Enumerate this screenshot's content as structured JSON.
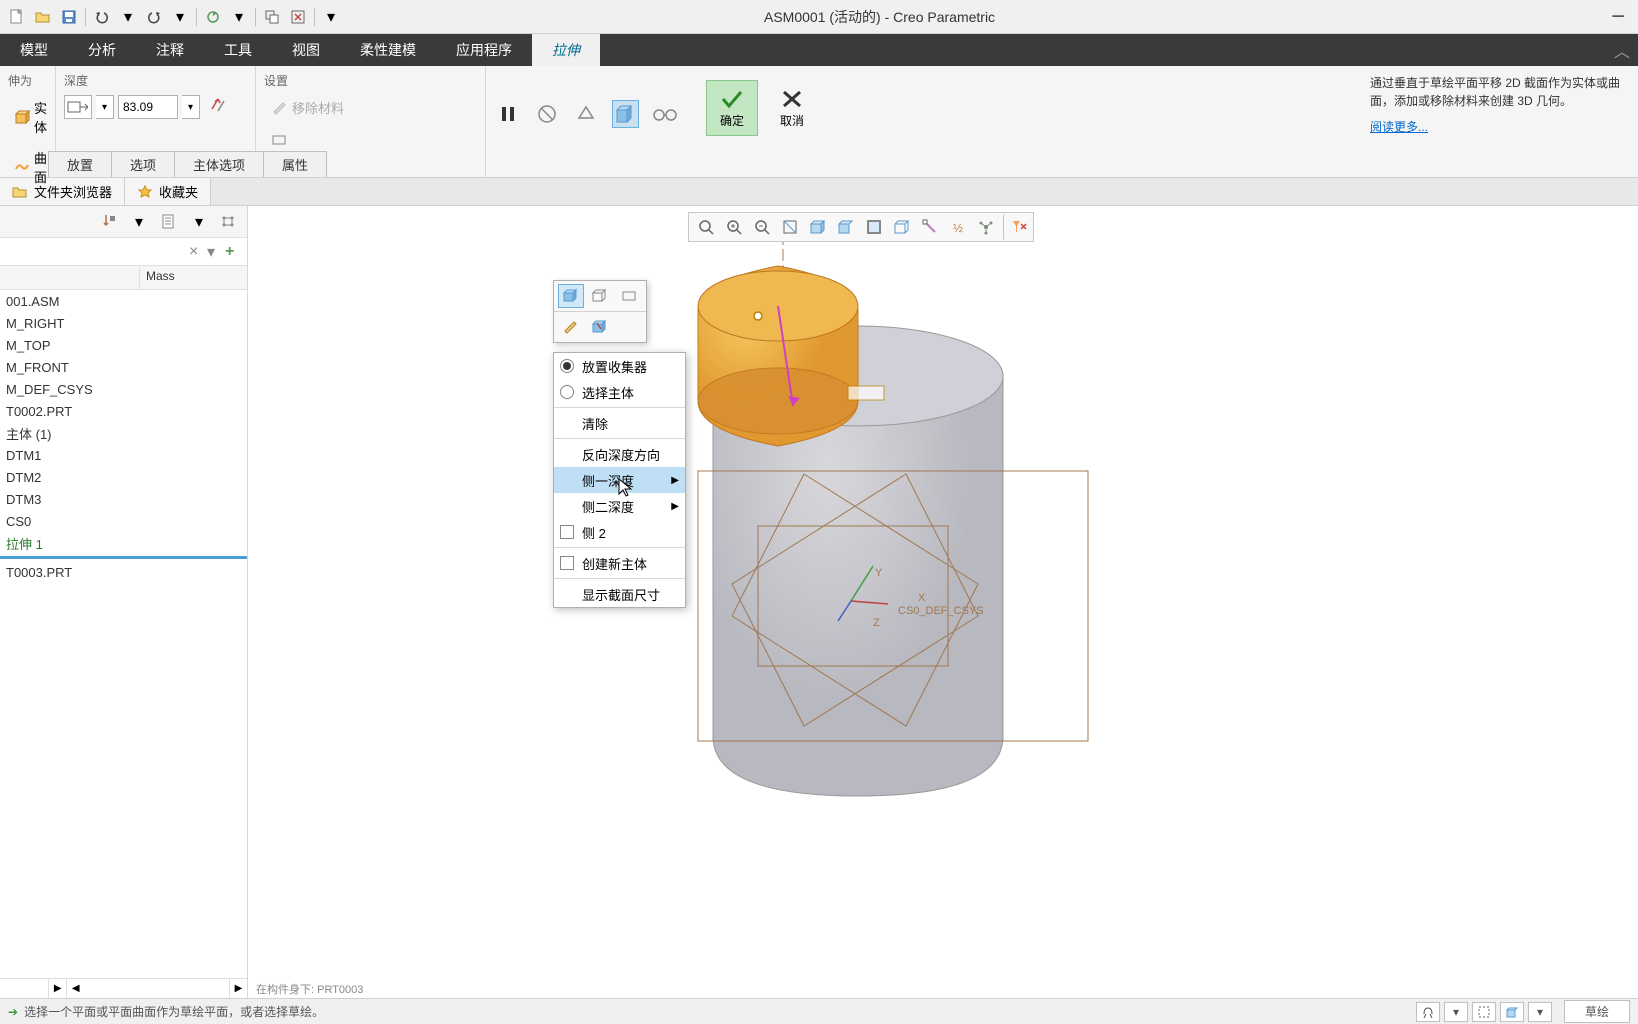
{
  "title": "ASM0001 (活动的) - Creo Parametric",
  "menubar": [
    "模型",
    "分析",
    "注释",
    "工具",
    "视图",
    "柔性建模",
    "应用程序",
    "拉伸"
  ],
  "menubar_active": 7,
  "ribbon": {
    "extrude_as_label": "伸为",
    "solid": "实体",
    "surface": "曲面",
    "depth_label": "深度",
    "depth_value": "83.09",
    "settings_label": "设置",
    "remove_material": "移除材料",
    "ok": "确定",
    "cancel": "取消",
    "help_text": "通过垂直于草绘平面平移 2D 截面作为实体或曲面，添加或移除材料来创建 3D 几何。",
    "help_link": "阅读更多...",
    "tabs": [
      "放置",
      "选项",
      "主体选项",
      "属性"
    ]
  },
  "browser_tabs": [
    "文件夹浏览器",
    "收藏夹"
  ],
  "tree": {
    "header_col2": "Mass",
    "items": [
      "001.ASM",
      "M_RIGHT",
      "M_TOP",
      "M_FRONT",
      "M_DEF_CSYS",
      "T0002.PRT",
      "主体 (1)",
      "DTM1",
      "DTM2",
      "DTM3",
      "CS0",
      "拉伸 1"
    ],
    "insert_item": "T0003.PRT"
  },
  "context_menu": {
    "items": [
      {
        "label": "放置收集器",
        "type": "radio",
        "checked": true
      },
      {
        "label": "选择主体",
        "type": "radio",
        "checked": false
      },
      {
        "label": "清除",
        "type": "plain",
        "sep_before": true
      },
      {
        "label": "反向深度方向",
        "type": "plain",
        "sep_before": true
      },
      {
        "label": "侧一深度",
        "type": "submenu",
        "highlight": true
      },
      {
        "label": "侧二深度",
        "type": "submenu"
      },
      {
        "label": "侧 2",
        "type": "check"
      },
      {
        "label": "创建新主体",
        "type": "check",
        "sep_before": true
      },
      {
        "label": "显示截面尺寸",
        "type": "plain",
        "sep_before": true
      }
    ]
  },
  "canvas_footer": "在构件身下: PRT0003",
  "csys_labels": {
    "x": "X",
    "y": "Y",
    "z": "Z",
    "name": "CS0_DEF_CSYS"
  },
  "status": {
    "text": "选择一个平面或平面曲面作为草绘平面，或者选择草绘。",
    "sketch_btn": "草绘"
  }
}
